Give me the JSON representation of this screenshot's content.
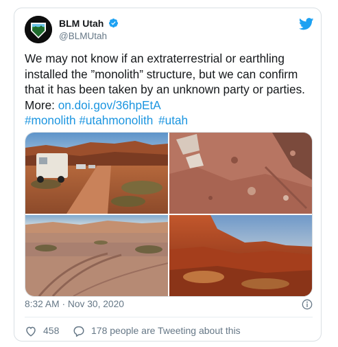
{
  "author": {
    "name": "BLM Utah",
    "handle": "@BLMUtah"
  },
  "tweet": {
    "text_main": "We may not know if an extraterrestrial or earthling installed the ”monolith” structure, but we can confirm that it has been taken by an unknown party or parties. More: ",
    "link": "on.doi.gov/36hpEtA",
    "hashtags": [
      "#monolith",
      "#utahmonolith",
      "#utah"
    ]
  },
  "timestamp": "8:32 AM · Nov 30, 2020",
  "actions": {
    "likes_count": "458",
    "replies_text": "178 people are Tweeting about this"
  },
  "colors": {
    "link": "#1b95e0",
    "secondary_text": "#657786",
    "like_icon": "#657786"
  },
  "icons": [
    "verified-badge-icon",
    "twitter-bird-icon",
    "info-icon",
    "heart-icon",
    "reply-bubble-icon"
  ]
}
